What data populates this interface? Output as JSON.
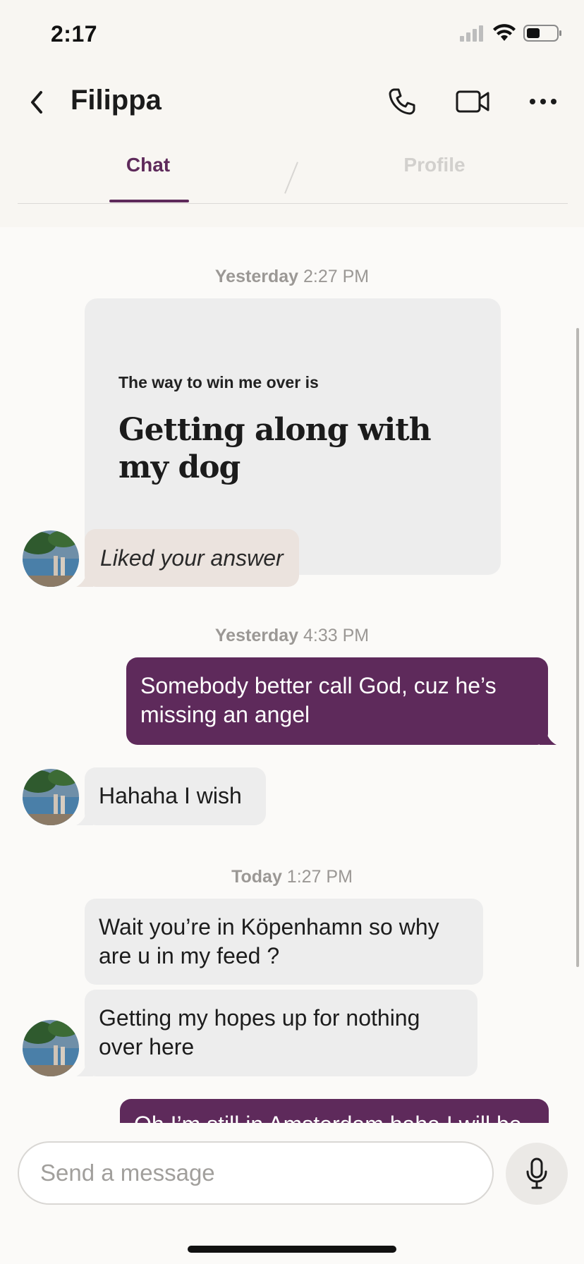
{
  "status_bar": {
    "time": "2:17"
  },
  "header": {
    "title": "Filippa"
  },
  "tabs": [
    {
      "label": "Chat",
      "active": true
    },
    {
      "label": "Profile",
      "active": false
    }
  ],
  "messages": {
    "ts1": {
      "day": "Yesterday",
      "time": "2:27 PM"
    },
    "prompt": {
      "question": "The way to win me over is",
      "answer": "Getting along with my dog"
    },
    "liked": "Liked your answer",
    "ts2": {
      "day": "Yesterday",
      "time": "4:33 PM"
    },
    "out1": "Somebody better call God, cuz he’s missing an angel",
    "in1": "Hahaha I wish",
    "ts3": {
      "day": "Today",
      "time": "1:27 PM"
    },
    "in2": "Wait you’re in Köpenhamn so why are u in my feed ?",
    "in3": "Getting my hopes up for nothing over here",
    "out2_partial": "Oh I’m still in Amsterdam haha I will be"
  },
  "composer": {
    "placeholder": "Send a message"
  },
  "colors": {
    "accent": "#5e2a5b",
    "bubble_in": "#ededed",
    "liked_bubble": "#ebe3de"
  }
}
